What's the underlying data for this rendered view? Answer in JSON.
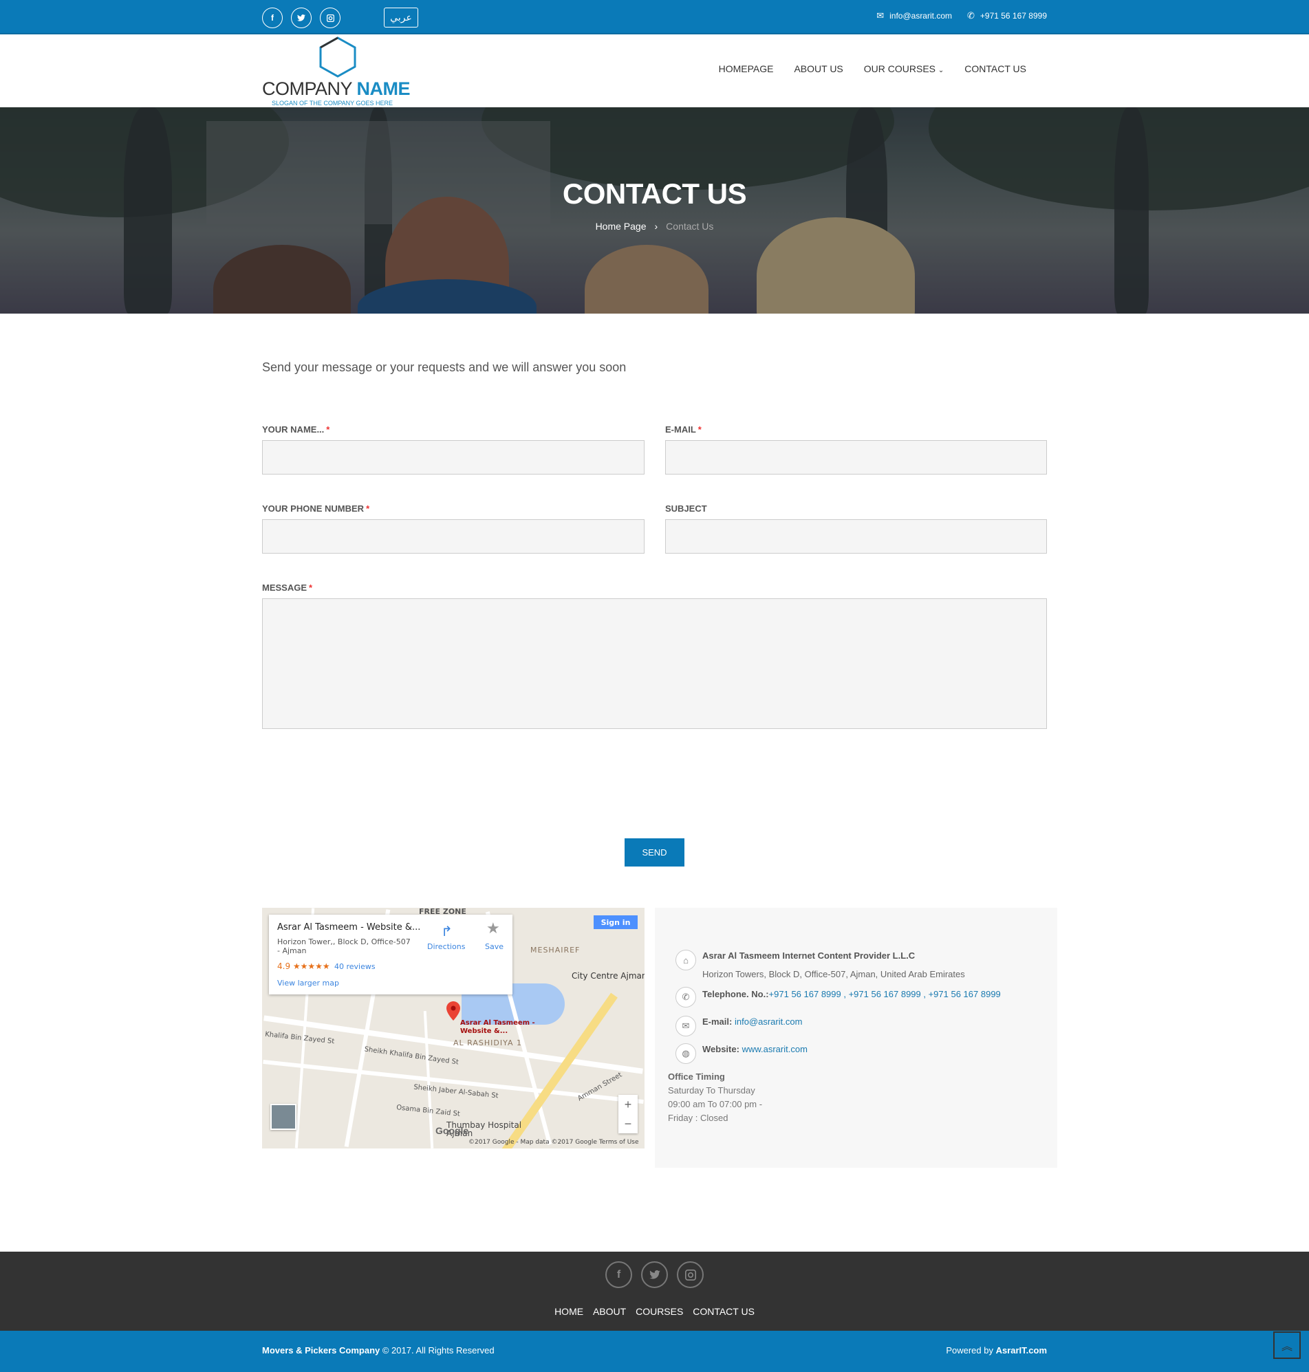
{
  "topbar": {
    "social": [
      "f",
      "t",
      "ig"
    ],
    "lang": "عربي",
    "email": "info@asrarit.com",
    "phone": "+971 56 167 8999"
  },
  "logo": {
    "name_a": "COMPANY ",
    "name_b": "NAME",
    "slogan": "SLOGAN OF THE COMPANY GOES HERE"
  },
  "nav": {
    "items": [
      "HOMEPAGE",
      "ABOUT US",
      "OUR COURSES",
      "CONTACT US"
    ]
  },
  "hero": {
    "title": "CONTACT US",
    "crumb_home": "Home Page",
    "crumb_current": "Contact Us"
  },
  "form": {
    "intro": "Send your message or your requests and we will answer you soon",
    "name_label": "YOUR NAME...",
    "email_label": "E-MAIL",
    "phone_label": "YOUR PHONE NUMBER",
    "subject_label": "SUBJECT",
    "message_label": "MESSAGE",
    "required_mark": "*",
    "send": "SEND"
  },
  "map": {
    "place_title": "Asrar Al Tasmeem - Website &...",
    "address": "Horizon Tower,, Block D, Office-507 - Ajman",
    "rating": "4.9 ★★★★★",
    "reviews": "40 reviews",
    "view_larger": "View larger map",
    "directions": "Directions",
    "save": "Save",
    "signin": "Sign in",
    "labels": {
      "free_zone": "FREE ZONE",
      "meshaireef": "MESHAIREF",
      "city_centre": "City Centre Ajman",
      "rashidiya": "AL RASHIDIYA 1",
      "pin_label": "Asrar Al Tasmeem - Website &...",
      "khalifa1": "Khalifa Bin Zayed St",
      "khalifa2": "Sheikh Khalifa Bin Zayed St",
      "jaber": "Sheikh Jaber Al-Sabah St",
      "osama": "Osama Bin Zaid St",
      "thumbay": "Thumbay Hospital Ajman",
      "ajman_st": "Amman Street"
    },
    "google": "Google",
    "legal": "©2017 Google - Map data ©2017 Google   Terms of Use"
  },
  "info": {
    "company": "Asrar Al Tasmeem Internet Content Provider L.L.C",
    "address": "Horizon Towers, Block D, Office-507, Ajman, United Arab Emirates",
    "tel_label": "Telephone. No.:",
    "tel_values": "+971 56 167 8999 , +971 56 167 8999 , +971 56 167 8999",
    "email_label": "E-mail:",
    "email_value": "info@asrarit.com",
    "web_label": "Website:",
    "web_value": "www.asrarit.com",
    "timing_title": "Office Timing",
    "timing_days": "Saturday To Thursday",
    "timing_hours": "09:00 am To 07:00 pm -",
    "timing_friday": "Friday : Closed"
  },
  "footer": {
    "links": [
      "HOME",
      "ABOUT",
      "COURSES",
      "CONTACT US"
    ],
    "copy_bold": "Movers & Pickers Company",
    "copy_rest": " © 2017. All Rights Reserved",
    "powered_pre": "Powered by ",
    "powered_bold": "AsrarIT.com"
  }
}
